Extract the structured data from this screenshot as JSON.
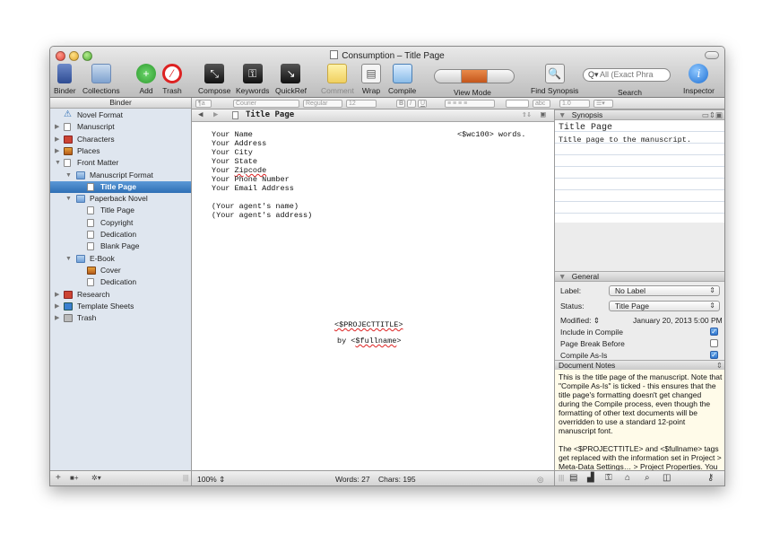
{
  "window": {
    "title": "Consumption – Title Page"
  },
  "toolbar": {
    "binder": "Binder",
    "collections": "Collections",
    "add": "Add",
    "trash": "Trash",
    "compose": "Compose",
    "keywords": "Keywords",
    "quickref": "QuickRef",
    "comment": "Comment",
    "wrap": "Wrap",
    "compile": "Compile",
    "view_mode": "View Mode",
    "find_synopsis": "Find Synopsis",
    "search": "Search",
    "search_placeholder": "All (Exact Phra",
    "inspector": "Inspector"
  },
  "formatbar": {
    "style": "¶a",
    "font": "Courier",
    "weight": "Regular",
    "size": "12",
    "bold": "B",
    "italic": "I",
    "underline": "U",
    "spacing": "1.0",
    "highlight": "abc"
  },
  "binder": {
    "header": "Binder",
    "items": [
      {
        "label": "Novel Format",
        "level": 0,
        "icon": "warning-icon",
        "expanded": null,
        "selected": false
      },
      {
        "label": "Manuscript",
        "level": 0,
        "icon": "manuscript-icon",
        "expanded": false,
        "selected": false
      },
      {
        "label": "Characters",
        "level": 0,
        "icon": "characters-icon",
        "expanded": false,
        "selected": false
      },
      {
        "label": "Places",
        "level": 0,
        "icon": "places-icon",
        "expanded": false,
        "selected": false
      },
      {
        "label": "Front Matter",
        "level": 0,
        "icon": "front-matter-icon",
        "expanded": true,
        "selected": false
      },
      {
        "label": "Manuscript Format",
        "level": 1,
        "icon": "folder-icon",
        "expanded": true,
        "selected": false
      },
      {
        "label": "Title Page",
        "level": 2,
        "icon": "document-icon",
        "expanded": null,
        "selected": true
      },
      {
        "label": "Paperback Novel",
        "level": 1,
        "icon": "folder-icon",
        "expanded": true,
        "selected": false
      },
      {
        "label": "Title Page",
        "level": 2,
        "icon": "document-icon",
        "expanded": null,
        "selected": false
      },
      {
        "label": "Copyright",
        "level": 2,
        "icon": "document-icon",
        "expanded": null,
        "selected": false
      },
      {
        "label": "Dedication",
        "level": 2,
        "icon": "document-icon",
        "expanded": null,
        "selected": false
      },
      {
        "label": "Blank Page",
        "level": 2,
        "icon": "document-icon",
        "expanded": null,
        "selected": false
      },
      {
        "label": "E-Book",
        "level": 1,
        "icon": "folder-icon",
        "expanded": true,
        "selected": false
      },
      {
        "label": "Cover",
        "level": 2,
        "icon": "image-icon",
        "expanded": null,
        "selected": false
      },
      {
        "label": "Dedication",
        "level": 2,
        "icon": "document-icon",
        "expanded": null,
        "selected": false
      },
      {
        "label": "Research",
        "level": 0,
        "icon": "research-icon",
        "expanded": false,
        "selected": false
      },
      {
        "label": "Template Sheets",
        "level": 0,
        "icon": "template-icon",
        "expanded": false,
        "selected": false
      },
      {
        "label": "Trash",
        "level": 0,
        "icon": "trash-icon",
        "expanded": false,
        "selected": false
      }
    ],
    "footer": {
      "add": "+",
      "folder": "■+",
      "gear": "✲▾"
    }
  },
  "editor": {
    "header_title": "Title Page",
    "lines": [
      "Your Name",
      "Your Address",
      "Your City",
      "Your State",
      "Your Zipcode",
      "Your Phone Number",
      "Your Email Address",
      "",
      "(Your agent's name)",
      "(Your agent's address)"
    ],
    "wordcount_tag": "<$wc100> words.",
    "project_title_tag": "<$PROJECTTITLE>",
    "byline_prefix": "by <",
    "byline_tag": "$fullname",
    "byline_suffix": ">",
    "zoom": "100%",
    "words": "Words: 27",
    "chars": "Chars: 195"
  },
  "inspector": {
    "synopsis_header": "Synopsis",
    "synopsis_title": "Title Page",
    "synopsis_text": "Title page to the manuscript.",
    "general_header": "General",
    "label_label": "Label:",
    "label_value": "No Label",
    "status_label": "Status:",
    "status_value": "Title Page",
    "modified_label": "Modified:",
    "modified_value": "January 20, 2013 5:00 PM",
    "include_compile": "Include in Compile",
    "include_compile_checked": true,
    "page_break": "Page Break Before",
    "page_break_checked": false,
    "compile_as_is": "Compile As-Is",
    "compile_as_is_checked": true,
    "notes_header": "Document Notes",
    "notes_p1": "This is the title page of the manuscript. Note that \"Compile As-Is\" is ticked - this ensures that the title page's formatting doesn't get changed during the Compile process, even though the formatting of other text documents will be overridden to use a standard 12-point manuscript font.",
    "notes_p2": "The <$PROJECTTITLE> and <$fullname> tags get replaced with the information set in Project > Meta-Data Settings… > Project Properties. You can edit those settings or just replace this text altogether. (Other information is taken from Address Book when the project is created.)"
  },
  "colors": {
    "selection": "#2e6fb5",
    "binder_bg": "#dfe6ef",
    "notes_bg": "#fffbe9",
    "accent_orange": "#c4561b"
  }
}
